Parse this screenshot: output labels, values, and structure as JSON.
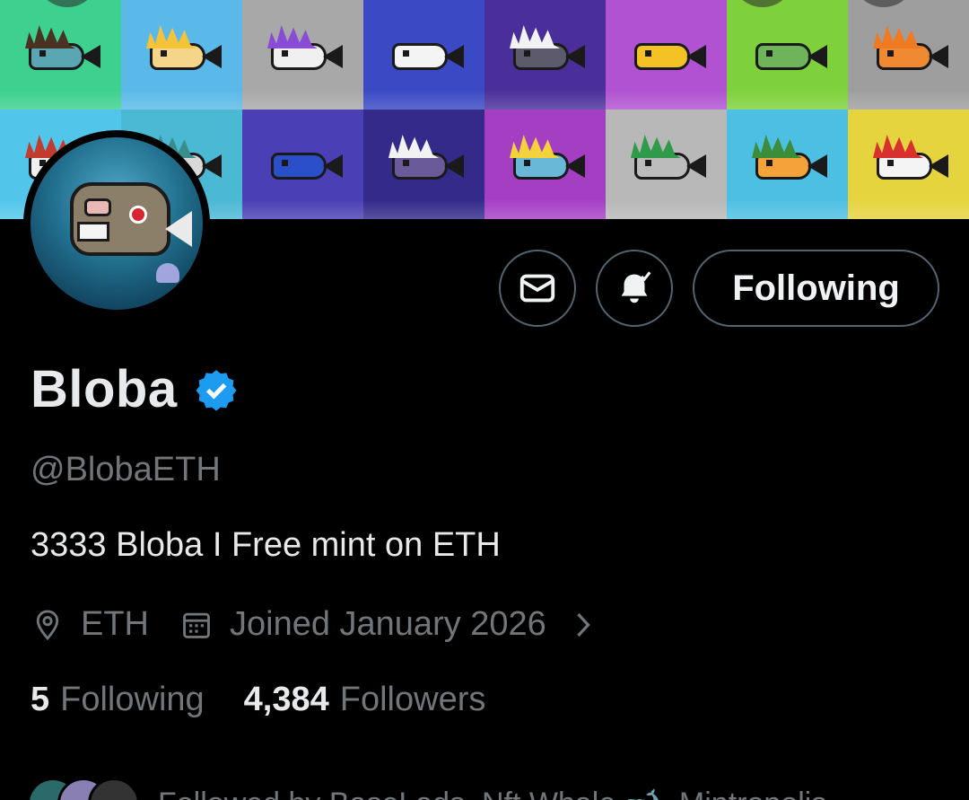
{
  "banner": {
    "tiles": [
      {
        "bg": "#3dd08f",
        "hair": "#4a3222",
        "fish": "#5aa7b3"
      },
      {
        "bg": "#5ab9e8",
        "hair": "#f5c33a",
        "fish": "#f4d58a"
      },
      {
        "bg": "#a8a8a8",
        "hair": "#8a4bd6",
        "fish": "#f0f0f0"
      },
      {
        "bg": "#3b49c4",
        "hair": "",
        "fish": "#f4f4f4"
      },
      {
        "bg": "#4a2f9a",
        "hair": "#f2f2f2",
        "fish": "#5b5b6b"
      },
      {
        "bg": "#b052d1",
        "hair": "",
        "fish": "#f4c223"
      },
      {
        "bg": "#7ed13c",
        "hair": "",
        "fish": "#6fb35a"
      },
      {
        "bg": "#9e9e9e",
        "hair": "#f07a22",
        "fish": "#f08a32"
      },
      {
        "bg": "#52c6ea",
        "hair": "#c13b2e",
        "fish": "#f0f0f0"
      },
      {
        "bg": "#4bb8d4",
        "hair": "#3a8d8d",
        "fish": "#d9d9d9"
      },
      {
        "bg": "#4a3fb5",
        "hair": "",
        "fish": "#2a4fc9"
      },
      {
        "bg": "#332a8a",
        "hair": "#f2f2f2",
        "fish": "#6a5a9a"
      },
      {
        "bg": "#a43fc4",
        "hair": "#f3d23b",
        "fish": "#6ab8d8"
      },
      {
        "bg": "#b8b8b8",
        "hair": "#2f9a4a",
        "fish": "#bcbcbc"
      },
      {
        "bg": "#4dbfe3",
        "hair": "#3b8d3a",
        "fish": "#f4a23a"
      },
      {
        "bg": "#e6d43f",
        "hair": "#d8302f",
        "fish": "#f4f4f4"
      }
    ]
  },
  "profile": {
    "display_name": "Bloba",
    "handle": "@BlobaETH",
    "bio": "3333 Bloba I Free mint on ETH",
    "location": "ETH",
    "joined": "Joined January 2026"
  },
  "actions": {
    "follow_label": "Following"
  },
  "stats": {
    "following_count": "5",
    "following_label": "Following",
    "followers_count": "4,384",
    "followers_label": "Followers"
  },
  "followed_by": {
    "text": "Followed by BaseLads, Nft Whale 🐋, Mintropolis"
  },
  "colors": {
    "background": "#000000",
    "text_primary": "#e7e9ea",
    "text_secondary": "#71767b",
    "border": "#536471",
    "verified": "#1d9bf0"
  },
  "icons": {
    "message": "envelope-icon",
    "notify": "bell-check-icon",
    "verified": "verified-badge-icon",
    "location": "map-pin-icon",
    "joined": "calendar-icon",
    "more": "chevron-right-icon"
  }
}
